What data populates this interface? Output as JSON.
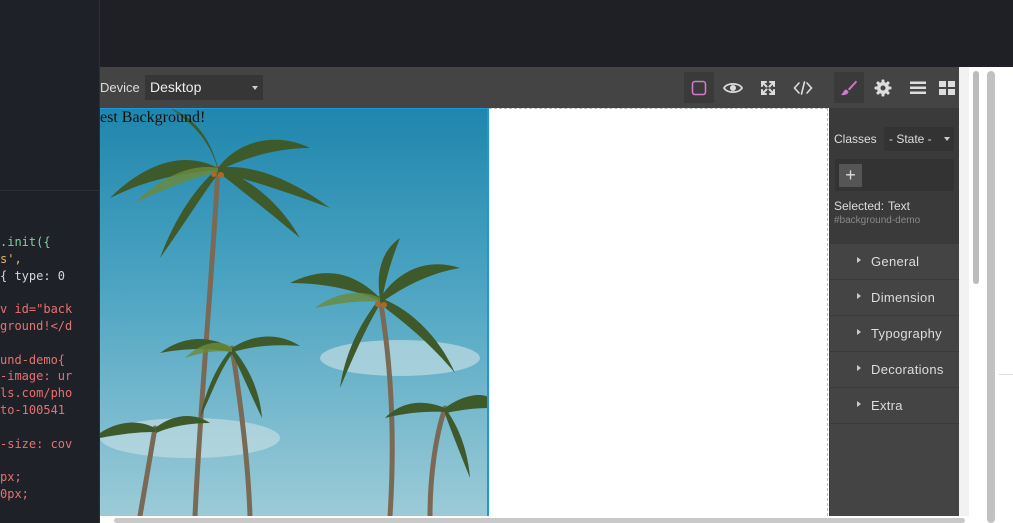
{
  "code_panel": {
    "lines": [
      {
        "text": ".init({",
        "color": "#7fd0a0"
      },
      {
        "text": "s',",
        "color": "#e5b567"
      },
      {
        "text": "{ type: 0",
        "color": "#d6d6d6"
      },
      {
        "text": "",
        "color": "#d6d6d6"
      },
      {
        "text": "v id=\"back",
        "color": "#e87070"
      },
      {
        "text": "ground!</d",
        "color": "#e87070"
      },
      {
        "text": "",
        "color": "#d6d6d6"
      },
      {
        "text": "und-demo{",
        "color": "#e87070"
      },
      {
        "text": "-image: ur",
        "color": "#e87070"
      },
      {
        "text": "ls.com/pho",
        "color": "#e87070"
      },
      {
        "text": "to-100541",
        "color": "#e87070"
      },
      {
        "text": "",
        "color": "#d6d6d6"
      },
      {
        "text": "-size: cov",
        "color": "#e87070"
      },
      {
        "text": "",
        "color": "#d6d6d6"
      },
      {
        "text": "px;",
        "color": "#e87070"
      },
      {
        "text": "0px;",
        "color": "#e87070"
      }
    ]
  },
  "toolbar": {
    "device_label": "Device",
    "device_value": "Desktop",
    "buttons": [
      {
        "name": "sw-visibility-icon",
        "active": true
      },
      {
        "name": "preview-eye-icon",
        "active": false
      },
      {
        "name": "fullscreen-icon",
        "active": false
      },
      {
        "name": "export-code-icon",
        "active": false
      }
    ]
  },
  "canvas": {
    "text": "est Background!"
  },
  "panel_tabs": [
    {
      "name": "style-manager-brush-icon",
      "active": true
    },
    {
      "name": "settings-gear-icon",
      "active": false
    },
    {
      "name": "layer-manager-icon",
      "active": false
    },
    {
      "name": "blocks-grid-icon",
      "active": false
    }
  ],
  "selector": {
    "classes_label": "Classes",
    "state_value": "- State -",
    "add_label": "+",
    "selected_label": "Selected:",
    "selected_value": "Text",
    "selected_id": "#background-demo"
  },
  "sectors": [
    "General",
    "Dimension",
    "Typography",
    "Decorations",
    "Extra"
  ],
  "colors": {
    "accent": "#d278c9",
    "selection": "#2196d6",
    "panel": "#444444"
  }
}
